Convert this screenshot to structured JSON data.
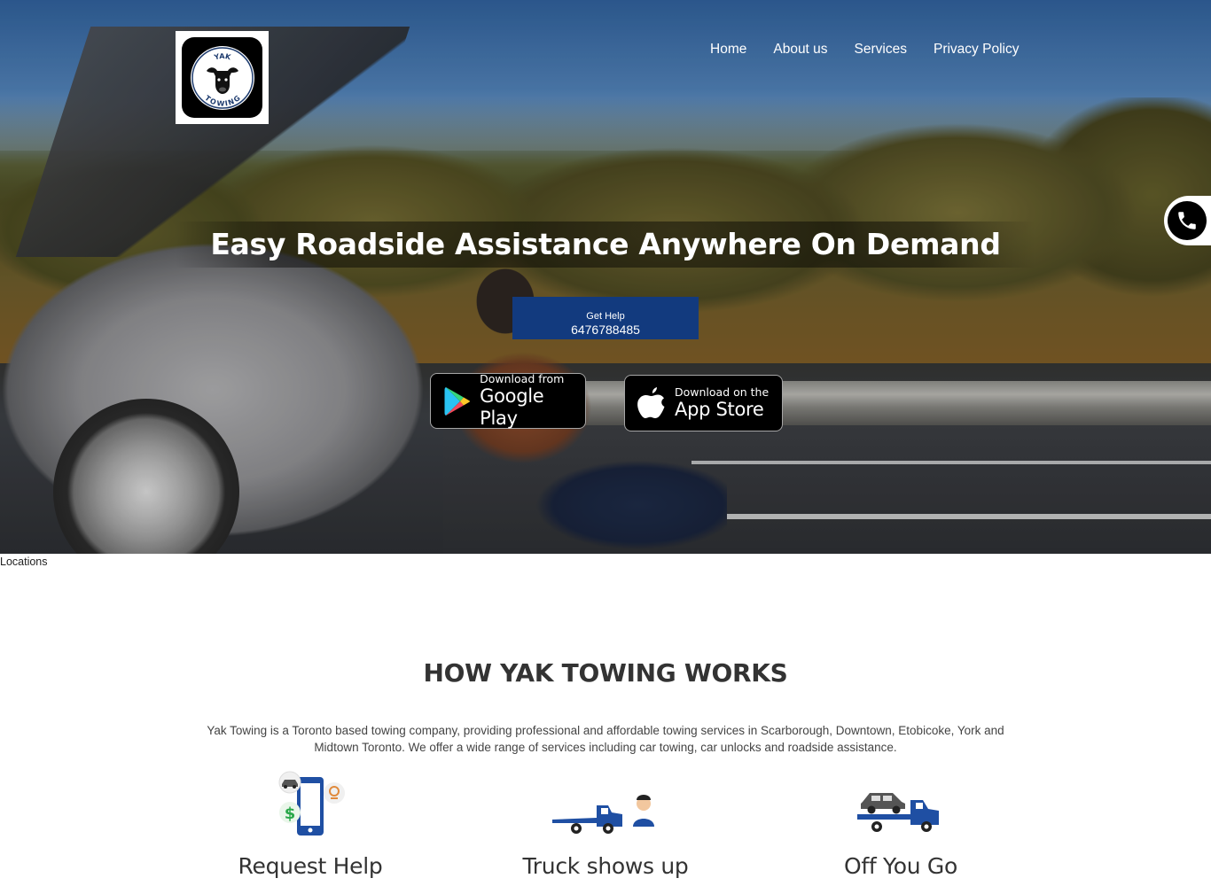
{
  "nav": {
    "items": [
      {
        "label": "Home"
      },
      {
        "label": "About us"
      },
      {
        "label": "Services"
      },
      {
        "label": "Privacy Policy"
      }
    ]
  },
  "logo": {
    "line1": "YAK",
    "line2": "TOWING"
  },
  "hero": {
    "headline": "Easy Roadside Assistance Anywhere On Demand",
    "get_help_label": "Get Help",
    "phone": "6476788485",
    "google_play": {
      "small": "Download from",
      "big": "Google Play"
    },
    "app_store": {
      "small": "Download on the",
      "big": "App Store"
    }
  },
  "locations_label": "Locations",
  "how": {
    "title": "HOW YAK TOWING WORKS",
    "description": "Yak Towing is a Toronto based towing company, providing professional and affordable towing services in Scarborough, Downtown, Etobicoke, York and Midtown Toronto. We offer a wide range of services including car towing, car unlocks and roadside assistance.",
    "steps": [
      {
        "label": "Request Help",
        "icon": "phone-request-icon"
      },
      {
        "label": "Truck shows up",
        "icon": "tow-truck-driver-icon"
      },
      {
        "label": "Off You Go",
        "icon": "tow-truck-car-icon"
      }
    ]
  },
  "colors": {
    "accent": "#123a7e",
    "icon_blue": "#1f4fa3",
    "text": "#333333"
  }
}
